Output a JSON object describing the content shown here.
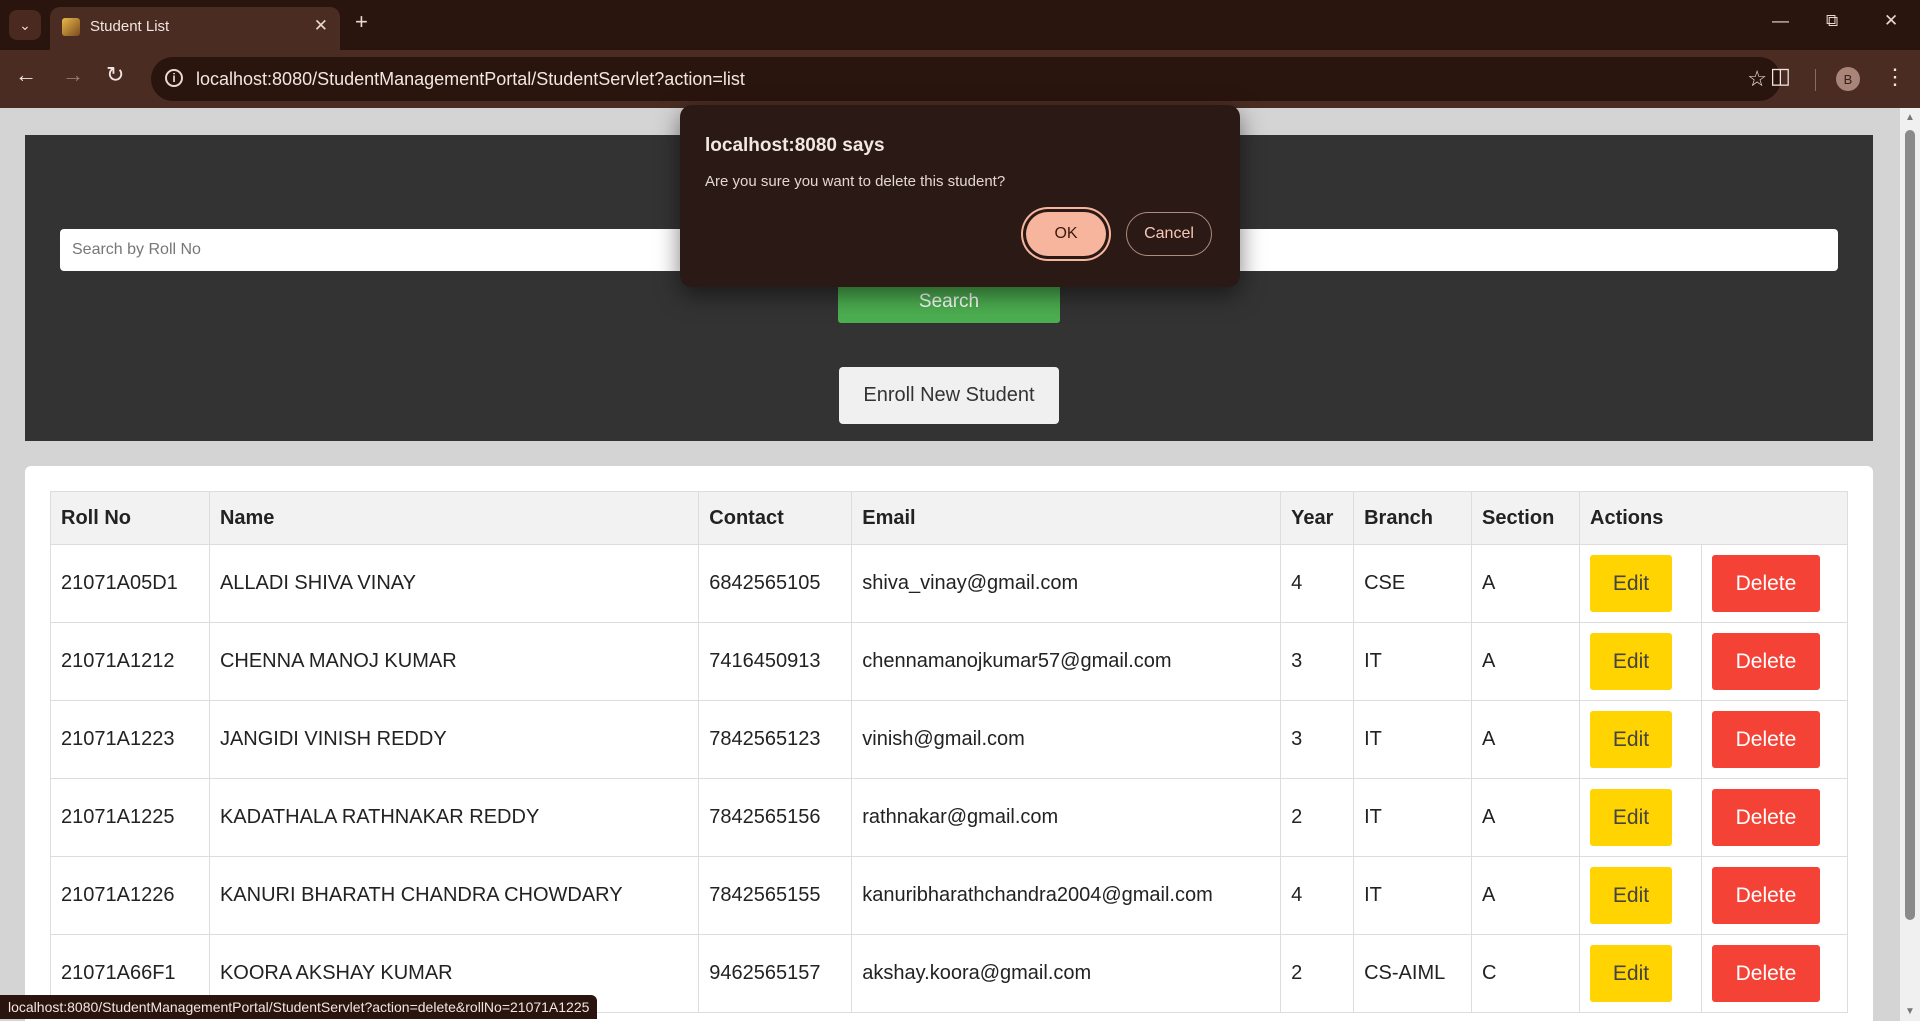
{
  "browser": {
    "tab_title": "Student List",
    "url": "localhost:8080/StudentManagementPortal/StudentServlet?action=list",
    "profile_initial": "B",
    "status_url": "localhost:8080/StudentManagementPortal/StudentServlet?action=delete&rollNo=21071A1225"
  },
  "search": {
    "placeholder": "Search by Roll No",
    "button_label": "Search"
  },
  "enroll_label": "Enroll New Student",
  "table": {
    "headers": [
      "Roll No",
      "Name",
      "Contact",
      "Email",
      "Year",
      "Branch",
      "Section",
      "Actions"
    ],
    "edit_label": "Edit",
    "delete_label": "Delete",
    "rows": [
      {
        "roll": "21071A05D1",
        "name": "ALLADI SHIVA VINAY",
        "contact": "6842565105",
        "email": "shiva_vinay@gmail.com",
        "year": "4",
        "branch": "CSE",
        "section": "A"
      },
      {
        "roll": "21071A1212",
        "name": "CHENNA MANOJ KUMAR",
        "contact": "7416450913",
        "email": "chennamanojkumar57@gmail.com",
        "year": "3",
        "branch": "IT",
        "section": "A"
      },
      {
        "roll": "21071A1223",
        "name": "JANGIDI VINISH REDDY",
        "contact": "7842565123",
        "email": "vinish@gmail.com",
        "year": "3",
        "branch": "IT",
        "section": "A"
      },
      {
        "roll": "21071A1225",
        "name": "KADATHALA RATHNAKAR REDDY",
        "contact": "7842565156",
        "email": "rathnakar@gmail.com",
        "year": "2",
        "branch": "IT",
        "section": "A"
      },
      {
        "roll": "21071A1226",
        "name": "KANURI BHARATH CHANDRA CHOWDARY",
        "contact": "7842565155",
        "email": "kanuribharathchandra2004@gmail.com",
        "year": "4",
        "branch": "IT",
        "section": "A"
      },
      {
        "roll": "21071A66F1",
        "name": "KOORA AKSHAY KUMAR",
        "contact": "9462565157",
        "email": "akshay.koora@gmail.com",
        "year": "2",
        "branch": "CS-AIML",
        "section": "C"
      }
    ]
  },
  "dialog": {
    "title": "localhost:8080 says",
    "message": "Are you sure you want to delete this student?",
    "ok_label": "OK",
    "cancel_label": "Cancel"
  },
  "colors": {
    "search_button": "#4caf50",
    "edit_button": "#ffd400",
    "delete_button": "#f44336",
    "header_panel": "#333333",
    "dialog_ok": "#f8b59e"
  }
}
